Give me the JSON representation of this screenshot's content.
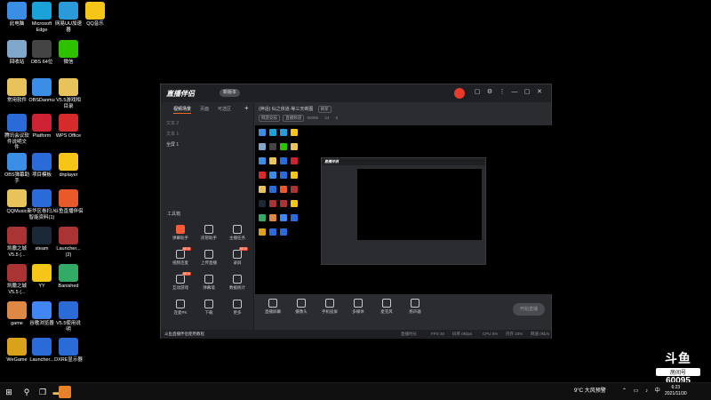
{
  "desktop_icons": [
    {
      "label": "此电脑",
      "color": "#3a8ee6"
    },
    {
      "label": "Microsoft\nEdge",
      "color": "#1aa3d9"
    },
    {
      "label": "网易UU加速\n器",
      "color": "#2a9bd8"
    },
    {
      "label": "QQ音乐",
      "color": "#f5c518"
    },
    {
      "label": "回收站",
      "color": "#7fa7c9"
    },
    {
      "label": "OBS 64位",
      "color": "#444"
    },
    {
      "label": "微信",
      "color": "#2dc100"
    },
    {
      "label": "常用软件",
      "color": "#e8c25a"
    },
    {
      "label": "OBSDanmu",
      "color": "#3a8ee6"
    },
    {
      "label": "V5.5游戏相\n目录",
      "color": "#e8c25a"
    },
    {
      "label": "腾讯会议软\n件说明文\n件",
      "color": "#2a6bd8"
    },
    {
      "label": "Platform",
      "color": "#c23"
    },
    {
      "label": "WPS Office",
      "color": "#d62b2b"
    },
    {
      "label": "OBS弹幕助\n手",
      "color": "#3a8ee6"
    },
    {
      "label": "项目模板",
      "color": "#2a6bd8"
    },
    {
      "label": "dnplayer",
      "color": "#f5c518"
    },
    {
      "label": "QQMusic",
      "color": "#e8c25a"
    },
    {
      "label": "新华区卷扫入\n智能资料(1)",
      "color": "#2a6bd8"
    },
    {
      "label": "斗鱼直播伴侣",
      "color": "#e85a2a"
    },
    {
      "label": "凯撒之城\nV5.5 (...",
      "color": "#a33"
    },
    {
      "label": "steam",
      "color": "#1b2838"
    },
    {
      "label": "Launcher...\n(2)",
      "color": "#a33"
    },
    {
      "label": "凯撒之城\nV5.5 (...",
      "color": "#a33"
    },
    {
      "label": "YY",
      "color": "#f5c518"
    },
    {
      "label": "Banished",
      "color": "#3a6"
    },
    {
      "label": "game",
      "color": "#d84"
    },
    {
      "label": "谷歌浏览器",
      "color": "#4285f4"
    },
    {
      "label": "V5.5使用说\n明",
      "color": "#2a6bd8"
    },
    {
      "label": "WeGame",
      "color": "#d9a21a"
    },
    {
      "label": "Launcher...",
      "color": "#2a6bd8"
    },
    {
      "label": "DXRE显示器",
      "color": "#2a6bd8"
    }
  ],
  "app": {
    "logo": "直播伴侣",
    "version": "新版本",
    "title_controls": [
      "▢",
      "⚙",
      "⋮",
      "—",
      "▢",
      "✕"
    ],
    "sidebar_tabs": [
      "视频场景",
      "页面",
      "可选区"
    ],
    "sidebar_add": "+",
    "scenes": [
      "文本 2",
      "文本 1",
      "全屏 1"
    ],
    "tools_title": "工具箱",
    "tools": [
      {
        "label": "弹幕助手",
        "hot": true
      },
      {
        "label": "房管助手",
        "hot": false
      },
      {
        "label": "主播任务",
        "hot": false
      },
      {
        "label": "视频连麦",
        "hot": false,
        "badge": "NEW"
      },
      {
        "label": "上传直播",
        "hot": false
      },
      {
        "label": "录屏",
        "hot": false,
        "badge": "NEW"
      },
      {
        "label": "互动游戏",
        "hot": false,
        "badge": "NEW"
      },
      {
        "label": "弹幕墙",
        "hot": false
      },
      {
        "label": "数据统计",
        "hot": false
      },
      {
        "label": "连麦PK",
        "hot": false
      },
      {
        "label": "下载",
        "hot": false
      },
      {
        "label": "更多",
        "hot": false
      }
    ],
    "sidebar_footer": "斗鱼直播伴侣使用教程",
    "room_tags": [
      "网游竞技",
      "直播频道"
    ],
    "room_title": "(神话) 仙之侠道·等三天断图",
    "room_extra": "刷新",
    "room_stats": {
      "id": "60095",
      "fans": "24",
      "viewers": "6",
      "level": "直播分区"
    },
    "bottom_tools": [
      "直播屏幕",
      "摄像头",
      "手机投屏",
      "多媒体",
      "麦克风",
      "扬声器"
    ],
    "start_button": "开始直播",
    "status": [
      "直播时长",
      "FPS 30",
      "码率 0kbps",
      "CPU 5%",
      "内存 23%",
      "网速 0kb/s"
    ]
  },
  "watermark": {
    "logo": "斗鱼",
    "room_label": "房间号",
    "room_number": "60095"
  },
  "taskbar": {
    "weather": "9°C 大风预警",
    "time": "6:23",
    "date": "2021/11/30",
    "apps": [
      "start-icon",
      "search-icon",
      "task-view-icon",
      "file-explorer-icon",
      "douyu-app-icon"
    ]
  }
}
